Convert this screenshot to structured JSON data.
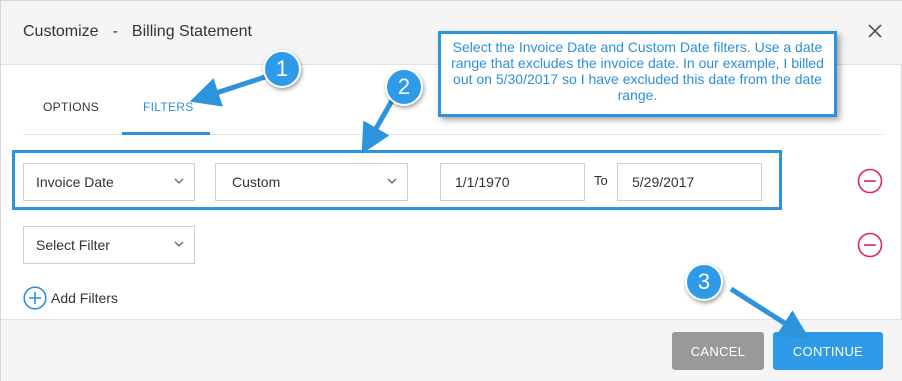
{
  "dialog": {
    "title": "Customize",
    "separator": "-",
    "subtitle": "Billing Statement"
  },
  "tabs": [
    {
      "label": "OPTIONS",
      "active": false
    },
    {
      "label": "FILTERS",
      "active": true
    }
  ],
  "filter_rows": [
    {
      "filter_select": "Invoice Date",
      "range_select": "Custom",
      "from_value": "1/1/1970",
      "to_label": "To",
      "to_value": "5/29/2017"
    },
    {
      "filter_select": "Select Filter"
    }
  ],
  "add_filters_label": "Add Filters",
  "buttons": {
    "cancel": "CANCEL",
    "continue": "CONTINUE"
  },
  "annotation": {
    "callout_text": "Select the Invoice Date and Custom Date filters. Use a date range that excludes the invoice date. In our example, I billed out on 5/30/2017 so I have excluded this date from the date range.",
    "steps": [
      "1",
      "2",
      "3"
    ]
  },
  "colors": {
    "accent": "#2e8fd9",
    "remove": "#e0245e",
    "cancel_bg": "#999999",
    "continue_bg": "#2e9ae8"
  },
  "icons": {
    "close": "close-icon",
    "chevron": "chevron-down-icon",
    "remove": "remove-circle-icon",
    "add": "add-circle-icon"
  }
}
